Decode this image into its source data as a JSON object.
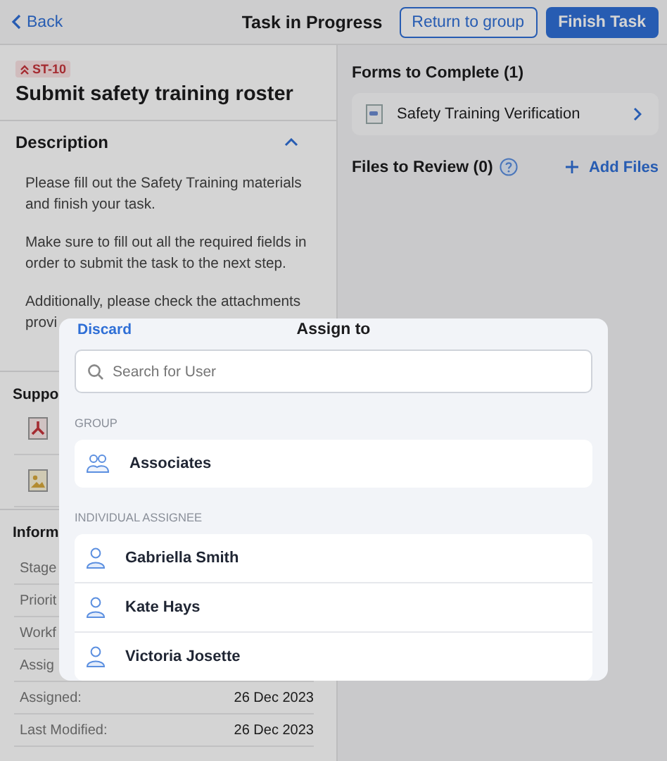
{
  "header": {
    "back": "Back",
    "title": "Task in Progress",
    "secondary_button": "Return to group",
    "primary_button": "Finish Task"
  },
  "task": {
    "code": "ST-10",
    "title": "Submit safety training roster"
  },
  "description": {
    "heading": "Description",
    "expanded": true,
    "paragraphs": [
      [
        "Please fill out the Safety Training materials",
        "and finish your task."
      ],
      [
        "Make sure to fill out all the required fields in",
        "order to submit the task to the next step."
      ],
      [
        "Additionally, please check the attachments",
        "provi"
      ]
    ]
  },
  "support": {
    "heading": "Suppo",
    "attachments": [
      {
        "kind": "pdf"
      },
      {
        "kind": "image"
      }
    ]
  },
  "information": {
    "heading": "Inform",
    "rows": [
      {
        "label": "Stage"
      },
      {
        "label": "Priorit"
      },
      {
        "label": "Workf"
      },
      {
        "label": "Assig"
      },
      {
        "label": "Assigned:",
        "value": "26 Dec 2023"
      },
      {
        "label": "Last Modified:",
        "value": "26 Dec 2023"
      }
    ]
  },
  "forms": {
    "heading": "Forms to Complete (1)",
    "items": [
      {
        "title": "Safety Training Verification"
      }
    ]
  },
  "files": {
    "heading": "Files to Review (0)",
    "add": "Add Files"
  },
  "modal": {
    "discard": "Discard",
    "title": "Assign to",
    "search_placeholder": "Search for User",
    "group_label": "GROUP",
    "groups": [
      {
        "name": "Associates"
      }
    ],
    "individual_label": "INDIVIDUAL ASSIGNEE",
    "assignees": [
      {
        "name": "Gabriella Smith"
      },
      {
        "name": "Kate Hays"
      },
      {
        "name": "Victoria Josette"
      }
    ]
  }
}
